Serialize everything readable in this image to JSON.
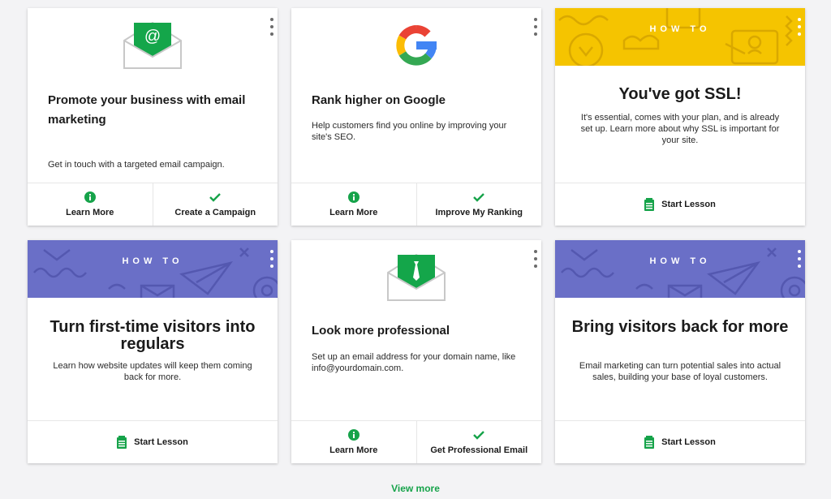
{
  "cards": [
    {
      "title": "Promote your business with email marketing",
      "description": "Get in touch with a targeted email campaign.",
      "icon": "email-envelope-icon",
      "actions": [
        {
          "label": "Learn More",
          "icon": "info-icon"
        },
        {
          "label": "Create a Campaign",
          "icon": "check-icon"
        }
      ]
    },
    {
      "title": "Rank higher on Google",
      "description": "Help customers find you online by improving your site's SEO.",
      "icon": "google-logo-icon",
      "actions": [
        {
          "label": "Learn More",
          "icon": "info-icon"
        },
        {
          "label": "Improve My Ranking",
          "icon": "check-icon"
        }
      ]
    },
    {
      "banner": "HOW TO",
      "title": "You've got SSL!",
      "description": "It's essential, comes with your plan, and is already set up. Learn more about why SSL is important for your site.",
      "actions": [
        {
          "label": "Start Lesson",
          "icon": "lesson-icon"
        }
      ]
    },
    {
      "banner": "HOW TO",
      "title": "Turn first-time visitors into regulars",
      "description": "Learn how website updates will keep them coming back for more.",
      "actions": [
        {
          "label": "Start Lesson",
          "icon": "lesson-icon"
        }
      ]
    },
    {
      "title": "Look more professional",
      "description": "Set up an email address for your domain name, like info@yourdomain.com.",
      "icon": "professional-email-icon",
      "actions": [
        {
          "label": "Learn More",
          "icon": "info-icon"
        },
        {
          "label": "Get Professional Email",
          "icon": "check-icon"
        }
      ]
    },
    {
      "banner": "HOW TO",
      "title": "Bring visitors back for more",
      "description": "Email marketing can turn potential sales into actual sales, building your base of loyal customers.",
      "actions": [
        {
          "label": "Start Lesson",
          "icon": "lesson-icon"
        }
      ]
    }
  ],
  "view_more": "View more",
  "colors": {
    "accent_green": "#16a34a",
    "banner_yellow": "#f5c400",
    "banner_blue": "#6a6fc7"
  }
}
